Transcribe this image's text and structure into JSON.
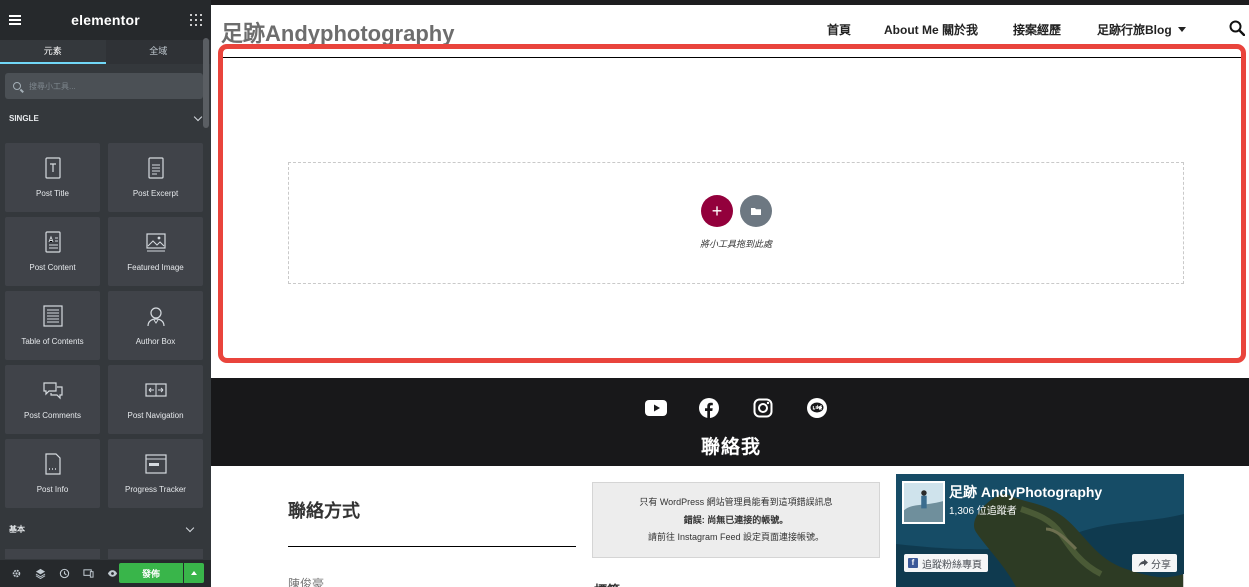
{
  "panel": {
    "brand": "elementor",
    "tabs": [
      "元素",
      "全域"
    ],
    "search_placeholder": "搜尋小工具...",
    "section_single": "SINGLE",
    "widgets": [
      {
        "label": "Post Title",
        "icon": "post-title-icon"
      },
      {
        "label": "Post Excerpt",
        "icon": "post-excerpt-icon"
      },
      {
        "label": "Post Content",
        "icon": "post-content-icon"
      },
      {
        "label": "Featured Image",
        "icon": "featured-image-icon"
      },
      {
        "label": "Table of Contents",
        "icon": "table-of-contents-icon"
      },
      {
        "label": "Author Box",
        "icon": "author-box-icon"
      },
      {
        "label": "Post Comments",
        "icon": "post-comments-icon"
      },
      {
        "label": "Post Navigation",
        "icon": "post-navigation-icon"
      },
      {
        "label": "Post Info",
        "icon": "post-info-icon"
      },
      {
        "label": "Progress Tracker",
        "icon": "progress-tracker-icon"
      }
    ],
    "section_basic": "基本",
    "publish_label": "發佈"
  },
  "site": {
    "title": "足跡Andyphotography",
    "nav": [
      "首頁",
      "About Me 關於我",
      "接案經歷",
      "足跡行旅Blog"
    ],
    "drop_hint": "將小工具拖到此處",
    "contact_title": "聯絡我",
    "contact_method": "聯絡方式",
    "contact_name": "陳俊豪",
    "instagram_notice": {
      "line1": "只有 WordPress 網站管理員能看到這項錯誤訊息",
      "line2": "錯誤: 尚無已連接的帳號。",
      "line3": "請前往 Instagram Feed 設定頁面連接帳號。"
    },
    "tag_heading": "標籤",
    "facebook": {
      "page_name": "足跡 AndyPhotography",
      "followers": "1,306 位追蹤者",
      "follow_label": "追蹤粉絲專頁",
      "share_label": "分享"
    }
  },
  "colors": {
    "panel_bg": "#34383c",
    "accent_tab": "#71d7f7",
    "publish_green": "#39b54a",
    "add_button": "#93003c",
    "highlight_red": "#e9443c"
  }
}
